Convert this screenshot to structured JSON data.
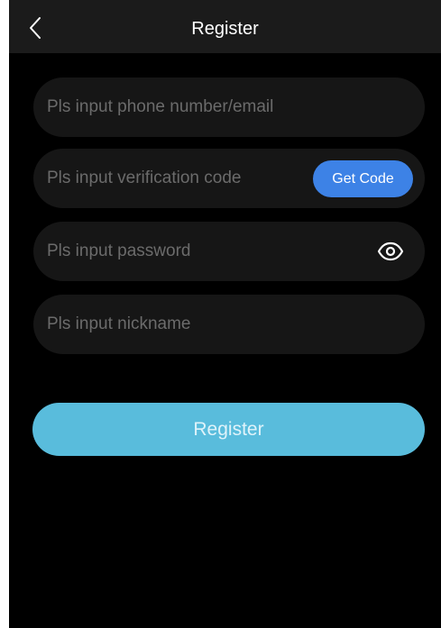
{
  "header": {
    "title": "Register"
  },
  "form": {
    "phone_placeholder": "Pls input phone number/email",
    "phone_value": "",
    "code_placeholder": "Pls input verification code",
    "code_value": "",
    "get_code_label": "Get Code",
    "password_placeholder": "Pls input password",
    "password_value": "",
    "nickname_placeholder": "Pls input nickname",
    "nickname_value": ""
  },
  "actions": {
    "register_label": "Register"
  },
  "icons": {
    "back": "chevron-left-icon",
    "password_toggle": "eye-icon"
  },
  "colors": {
    "background": "#000000",
    "header": "#1b1b1b",
    "field": "#161616",
    "placeholder": "#6b6b6b",
    "get_code": "#3d82e6",
    "register_button": "#59bcdc"
  }
}
